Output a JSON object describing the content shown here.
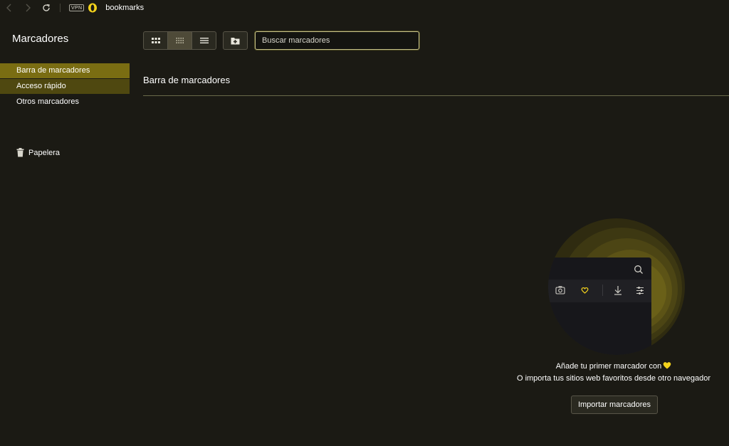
{
  "addressbar": {
    "vpn_label": "VPN",
    "url": "bookmarks"
  },
  "sidebar": {
    "title": "Marcadores",
    "items": [
      {
        "label": "Barra de marcadores"
      },
      {
        "label": "Acceso rápido"
      },
      {
        "label": "Otros marcadores"
      }
    ],
    "trash_label": "Papelera"
  },
  "toolbar": {
    "search_placeholder": "Buscar marcadores"
  },
  "content": {
    "title": "Barra de marcadores"
  },
  "empty_state": {
    "line1": "Añade tu primer marcador con",
    "line2": "O importa tus sitios web favoritos desde otro navegador",
    "import_button": "Importar marcadores"
  },
  "colors": {
    "background": "#1b1a14",
    "selected": "#7a6d12",
    "hover": "#4f4810",
    "accent_yellow": "#f3d21c",
    "opera_red": "#e0a20f"
  }
}
